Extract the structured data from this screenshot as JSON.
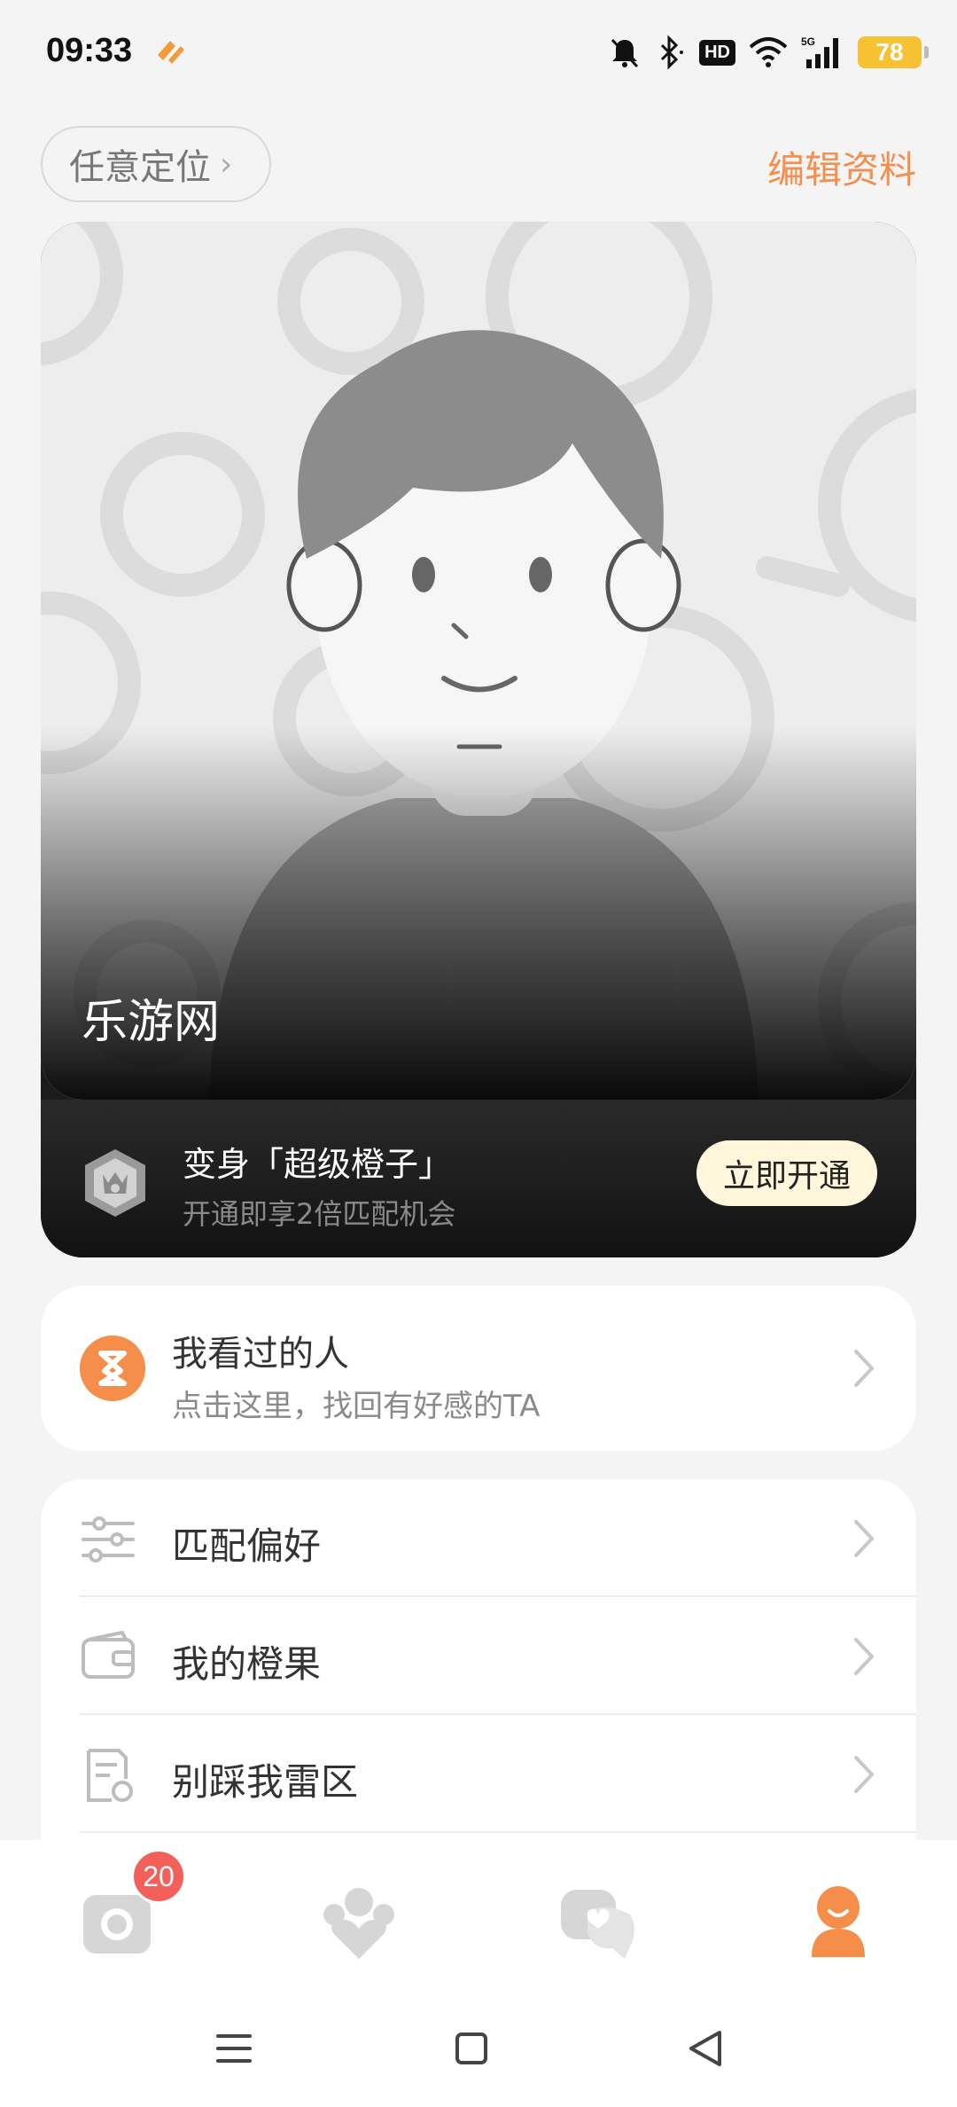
{
  "status_bar": {
    "time": "09:33",
    "battery": "78",
    "hd_label": "HD",
    "net_label": "5G"
  },
  "header": {
    "location_label": "任意定位",
    "edit_label": "编辑资料"
  },
  "profile": {
    "name": "乐游网",
    "vip_title": "变身「超级橙子」",
    "vip_subtitle": "开通即享2倍匹配机会",
    "vip_button": "立即开通"
  },
  "visited": {
    "title": "我看过的人",
    "subtitle": "点击这里，找回有好感的TA"
  },
  "menu": {
    "items": [
      {
        "label": "匹配偏好",
        "icon": "sliders-icon"
      },
      {
        "label": "我的橙果",
        "icon": "wallet-icon"
      },
      {
        "label": "别踩我雷区",
        "icon": "document-icon"
      }
    ]
  },
  "bottom_nav": {
    "tabs": [
      "camera-icon",
      "match-icon",
      "chat-icon",
      "profile-icon"
    ],
    "badge_count": "20",
    "active_color": "#f58e4b",
    "inactive_color": "#d6d6d6"
  },
  "colors": {
    "accent": "#f3904f",
    "badge": "#f3605a"
  }
}
